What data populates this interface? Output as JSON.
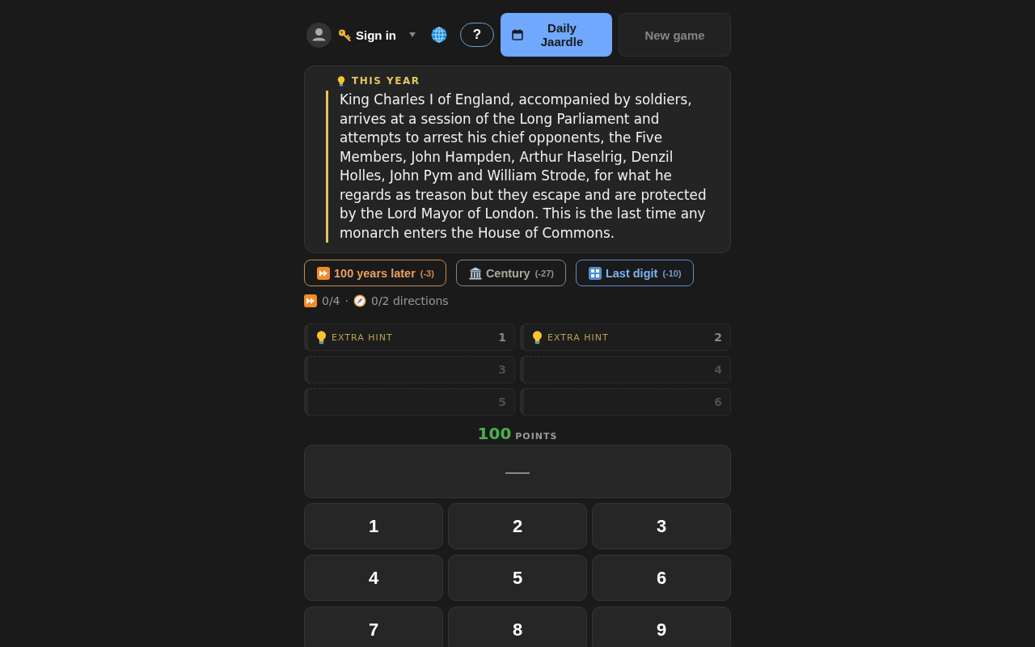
{
  "header": {
    "sign_in": "Sign in",
    "help_button": "?",
    "daily_button": "Daily Jaardle",
    "new_game_button": {
      "label": "New game",
      "disabled": true
    }
  },
  "clue": {
    "heading": "THIS YEAR",
    "text": "King Charles I of England, accompanied by soldiers, arrives at a session of the Long Parliament and attempts to arrest his chief opponents, the Five Members, John Hampden, Arthur Haselrig, Denzil Holles, John Pym and William Strode, for what he regards as treason but they escape and are protected by the Lord Mayor of London. This is the last time any monarch enters the House of Commons."
  },
  "hint_buttons": [
    {
      "kind": "later",
      "label": "100 years later",
      "cost": "(-3)"
    },
    {
      "kind": "century",
      "label": "Century",
      "cost": "(-27)"
    },
    {
      "kind": "digit",
      "label": "Last digit",
      "cost": "(-10)"
    }
  ],
  "progress": {
    "later_count": "0/4",
    "separator": "·",
    "directions": "0/2 directions"
  },
  "extra_hints": [
    {
      "number": "1",
      "label": "EXTRA HINT",
      "unlocked": true
    },
    {
      "number": "2",
      "label": "EXTRA HINT",
      "unlocked": true
    },
    {
      "number": "3",
      "unlocked": false
    },
    {
      "number": "4",
      "unlocked": false
    },
    {
      "number": "5",
      "unlocked": false
    },
    {
      "number": "6",
      "unlocked": false
    }
  ],
  "score": {
    "value": "100",
    "unit": "POINTS"
  },
  "answer": {
    "value": "—"
  },
  "keypad": [
    "1",
    "2",
    "3",
    "4",
    "5",
    "6",
    "7",
    "8",
    "9"
  ]
}
